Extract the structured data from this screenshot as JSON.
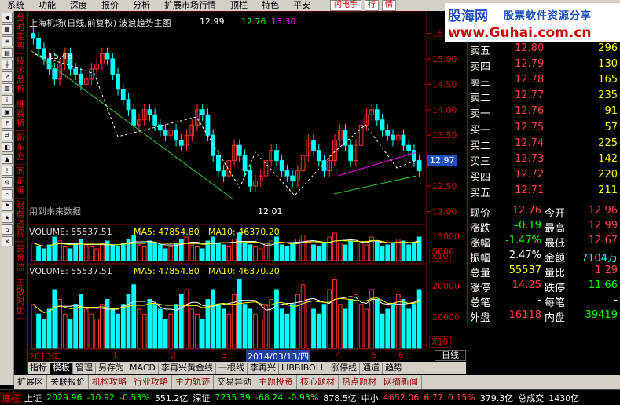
{
  "menu": [
    "系统",
    "功能",
    "深度",
    "报价",
    "分析",
    "扩展市场行情",
    "顶栏",
    "特色",
    "平安"
  ],
  "menu_btns": {
    "flash": "闪电手",
    "trade": "行",
    "quote": "情"
  },
  "logo": {
    "cn": "股海网",
    "slogan": "股票软件资源分享",
    "url": "www.Guhai.com.cn"
  },
  "side_tabs": [
    "分时走势",
    "技术分析",
    "维赛特",
    "新东方",
    "同花顺",
    "财务透视",
    "资金流",
    "主散对比"
  ],
  "chart": {
    "title": "上海机场(日线,前复权) 波浪趋势主图",
    "price": "12.99",
    "val1": "12.76",
    "val2": "13.30",
    "high_label": "15.48",
    "low_label": "12.01",
    "current_label": "12.97",
    "future_note": "用到未来数据",
    "y_ticks": [
      "15.50",
      "15.00",
      "14.50",
      "14.00",
      "13.50",
      "13.00",
      "12.50",
      "12.00"
    ],
    "vol1_header": {
      "name": "VOLUME: 55537.51",
      "ma5": "MA5: 47854.80",
      "ma10": "MA10: 46370.20"
    },
    "vol1_ticks": [
      "15000",
      "5000"
    ],
    "vol1_unit": "X10",
    "vol2_header": {
      "name": "VOLUME: 55537.51",
      "ma5": "MA5: 47854.80",
      "ma10": "MA10: 46370.20"
    },
    "vol2_ticks": [
      "20000",
      "10000"
    ],
    "vol2_unit": "X10",
    "date_labels": [
      "2013年",
      "1",
      "2",
      "3",
      "2014/03/13/四",
      "4",
      "5",
      "6"
    ],
    "range_btn": "日线"
  },
  "chart_data": {
    "type": "candlestick",
    "ylim": [
      11.9,
      15.6
    ],
    "closes": [
      15.4,
      15.2,
      15.0,
      14.8,
      14.6,
      14.9,
      15.1,
      14.8,
      14.7,
      14.5,
      14.6,
      14.8,
      14.9,
      15.1,
      15.0,
      14.7,
      14.4,
      14.2,
      14.0,
      13.7,
      13.8,
      14.0,
      13.9,
      13.7,
      13.6,
      13.5,
      13.6,
      13.4,
      13.3,
      13.5,
      13.7,
      14.0,
      13.9,
      13.5,
      13.1,
      12.8,
      12.7,
      13.0,
      13.3,
      13.1,
      12.8,
      12.5,
      12.6,
      12.7,
      13.0,
      13.2,
      13.0,
      12.8,
      12.7,
      12.6,
      12.8,
      13.1,
      13.4,
      13.2,
      13.0,
      12.8,
      13.0,
      13.4,
      13.6,
      13.3,
      13.0,
      13.3,
      13.7,
      13.9,
      14.0,
      13.8,
      13.6,
      13.5,
      13.4,
      13.5,
      13.3,
      13.2,
      13.0,
      12.8
    ],
    "volumes": [
      9,
      7,
      6,
      8,
      12,
      10,
      7,
      6,
      9,
      11,
      8,
      7,
      6,
      9,
      10,
      8,
      7,
      9,
      11,
      13,
      8,
      7,
      10,
      9,
      8,
      6,
      7,
      9,
      11,
      12,
      8,
      7,
      6,
      10,
      12,
      9,
      8,
      7,
      11,
      14,
      9,
      8,
      7,
      6,
      9,
      10,
      12,
      8,
      7,
      9,
      11,
      13,
      10,
      8,
      7,
      9,
      12,
      14,
      9,
      8,
      10,
      11,
      9,
      8,
      12,
      10,
      7,
      8,
      9,
      11,
      10,
      8,
      9,
      12
    ]
  },
  "quote": {
    "sell": [
      {
        "label": "卖五",
        "price": "12.80",
        "vol": "296"
      },
      {
        "label": "卖四",
        "price": "12.79",
        "vol": "130"
      },
      {
        "label": "卖三",
        "price": "12.78",
        "vol": "165"
      },
      {
        "label": "卖二",
        "price": "12.77",
        "vol": "235"
      },
      {
        "label": "卖一",
        "price": "12.76",
        "vol": "91"
      }
    ],
    "buy": [
      {
        "label": "买一",
        "price": "12.75",
        "vol": "57"
      },
      {
        "label": "买二",
        "price": "12.74",
        "vol": "225"
      },
      {
        "label": "买三",
        "price": "12.73",
        "vol": "142"
      },
      {
        "label": "买四",
        "price": "12.72",
        "vol": "220"
      },
      {
        "label": "买五",
        "price": "12.71",
        "vol": "211"
      }
    ],
    "stats": [
      {
        "l1": "现价",
        "v1": "12.76",
        "l2": "今开",
        "v2": "12.96"
      },
      {
        "l1": "涨跌",
        "v1": "-0.19",
        "l2": "最高",
        "v2": "12.99"
      },
      {
        "l1": "涨幅",
        "v1": "-1.47%",
        "l2": "最低",
        "v2": "12.67"
      },
      {
        "l1": "振幅",
        "v1": "2.47%",
        "l2": "金额",
        "v2": "7104万"
      },
      {
        "l1": "总量",
        "v1": "55537",
        "l2": "量比",
        "v2": "1.29"
      },
      {
        "l1": "涨停",
        "v1": "14.25",
        "l2": "跌停",
        "v2": "11.66"
      },
      {
        "l1": "总笔",
        "v1": "-",
        "l2": "每笔",
        "v2": "-"
      },
      {
        "l1": "外盘",
        "v1": "16118",
        "l2": "内盘",
        "v2": "39419"
      }
    ]
  },
  "bottom_tabs": [
    "指标",
    "模板",
    "管理",
    "另存为",
    "MACD",
    "李再兴黄金线",
    "一根线",
    "李再兴",
    "LIBBIBOLL",
    "涨停线",
    "通道",
    "趋势"
  ],
  "category_tabs": [
    "扩展区",
    "关联报价",
    "机构攻略",
    "行业攻略",
    "主力轨迹",
    "交易异动",
    "主题投资",
    "核心题材",
    "热点题材",
    "网摘新闻"
  ],
  "status": {
    "label": "底栏",
    "sh_name": "上证",
    "sh_val": "2029.96",
    "sh_chg": "-10.92",
    "sh_pct": "-0.53%",
    "sh_amt": "551.2亿",
    "sz_name": "深证",
    "sz_val": "7235.39",
    "sz_chg": "-68.24",
    "sz_pct": "-0.93%",
    "sz_amt": "878.5亿",
    "zx_name": "中小",
    "zx_val": "4652.06",
    "zx_chg": "6.77",
    "zx_pct": "0.15%",
    "zx_amt": "379.3亿",
    "deal": "总成交",
    "deal_amt": "1430亿"
  }
}
